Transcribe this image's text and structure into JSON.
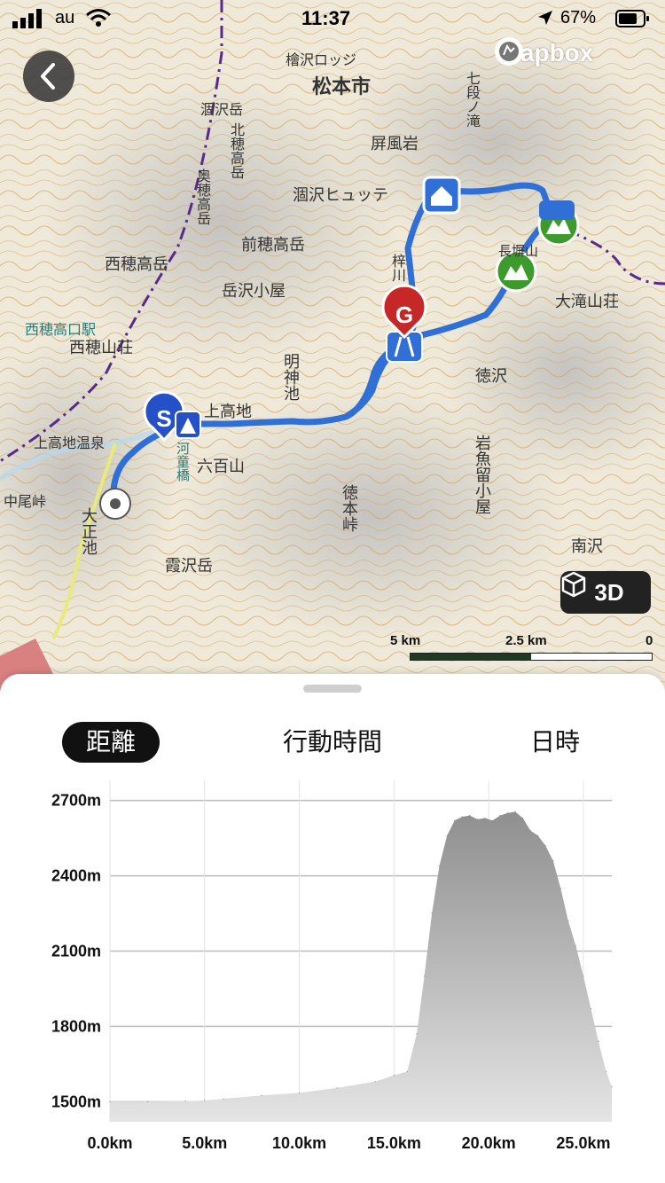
{
  "status_bar": {
    "carrier": "au",
    "time": "11:37",
    "battery": "67%"
  },
  "map": {
    "attribution": "mapbox",
    "view_mode_button": "3D",
    "scale_labels": [
      "5 km",
      "2.5 km",
      "0"
    ],
    "places": [
      "松本市",
      "檜沢ロッジ",
      "屏風岩",
      "涸沢ヒュッテ",
      "前穂高岳",
      "西穂高岳",
      "岳沢小屋",
      "西穂高口駅",
      "西穂山荘",
      "上高地",
      "上高地温泉",
      "六百山",
      "大正池",
      "霞沢岳",
      "明神池",
      "徳本峠",
      "岩魚留小屋",
      "徳沢",
      "大滝山荘",
      "長塀山",
      "南沢",
      "中尾峠",
      "北穂高岳",
      "奥穂高岳",
      "涸沢岳",
      "河童橋",
      "梓川",
      "七段ノ滝"
    ],
    "markers": {
      "start_label": "S",
      "goal_label": "G"
    },
    "colors": {
      "route": "#2f6fd6",
      "start_marker": "#2650c8",
      "goal_marker": "#c62828",
      "peak_marker": "#3d9a2c"
    }
  },
  "panel": {
    "tabs": [
      {
        "label": "距離",
        "active": true
      },
      {
        "label": "行動時間",
        "active": false
      },
      {
        "label": "日時",
        "active": false
      }
    ]
  },
  "chart_data": {
    "type": "area",
    "xlabel": "",
    "ylabel": "",
    "x_unit": "km",
    "y_unit": "m",
    "xlim": [
      0,
      26.5
    ],
    "ylim": [
      1420,
      2780
    ],
    "x_ticks": [
      "0.0km",
      "5.0km",
      "10.0km",
      "15.0km",
      "20.0km",
      "25.0km"
    ],
    "y_ticks": [
      "2700m",
      "2400m",
      "2100m",
      "1800m",
      "1500m"
    ],
    "grid": true,
    "series": [
      {
        "x": [
          0,
          2,
          4,
          5,
          6,
          8,
          10,
          12,
          14,
          15,
          15.7,
          16.2,
          16.6,
          17.0,
          17.4,
          17.8,
          18.2,
          18.6,
          19.0,
          19.4,
          19.8,
          20.2,
          20.6,
          21.0,
          21.4,
          21.8,
          22.2,
          22.6,
          23.0,
          23.4,
          23.8,
          24.2,
          24.6,
          25.0,
          25.4,
          25.8,
          26.2,
          26.5
        ],
        "y": [
          1500,
          1500,
          1502,
          1505,
          1512,
          1525,
          1535,
          1555,
          1580,
          1605,
          1620,
          1770,
          2000,
          2250,
          2440,
          2560,
          2620,
          2635,
          2640,
          2625,
          2630,
          2620,
          2640,
          2650,
          2655,
          2630,
          2580,
          2560,
          2520,
          2460,
          2350,
          2220,
          2120,
          2000,
          1870,
          1740,
          1620,
          1560
        ]
      }
    ]
  }
}
